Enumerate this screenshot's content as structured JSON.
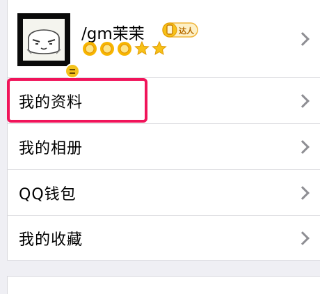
{
  "profile": {
    "username": "/gm茉茉",
    "talent_badge": "达人",
    "level_icons": [
      "sun-icon",
      "sun-icon",
      "sun-icon",
      "star-icon",
      "star-icon"
    ]
  },
  "menu": {
    "items": [
      {
        "label": "我的资料"
      },
      {
        "label": "我的相册"
      },
      {
        "label": "QQ钱包"
      },
      {
        "label": "我的收藏"
      }
    ]
  },
  "colors": {
    "highlight": "#f0145a",
    "sun": "#f4b400",
    "star": "#f7c118"
  }
}
